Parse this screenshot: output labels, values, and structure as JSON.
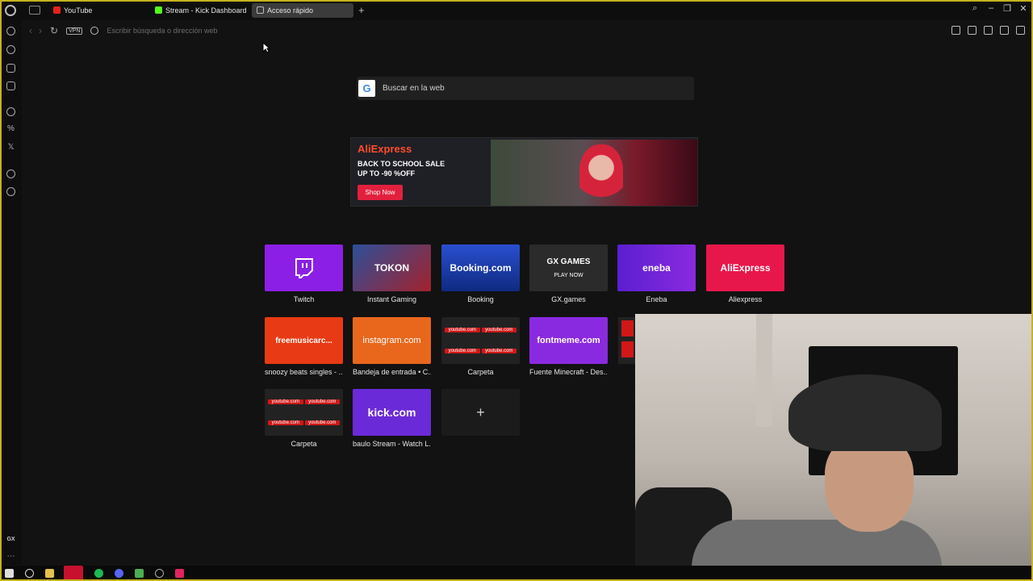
{
  "tabs": [
    {
      "label": "YouTube"
    },
    {
      "label": "Stream - Kick Dashboard"
    },
    {
      "label": "Acceso rápido"
    }
  ],
  "address": {
    "placeholder": "Escribir búsqueda o dirección web",
    "vpn_label": "VPN"
  },
  "sidebar": {
    "gx_label": "GX"
  },
  "search": {
    "label": "Buscar en la web",
    "g": "G"
  },
  "ad": {
    "brand": "AliExpress",
    "line1": "BACK TO SCHOOL SALE",
    "line2": "UP TO  -90 %OFF",
    "button": "Shop Now"
  },
  "speed_dial": [
    {
      "label": "Twitch",
      "thumb": "",
      "color": "#8c1fe6"
    },
    {
      "label": "Instant Gaming",
      "thumb": "TOKON",
      "color": "#2d4f9a"
    },
    {
      "label": "Booking",
      "thumb": "Booking.com",
      "color": "#1a47b8"
    },
    {
      "label": "GX.games",
      "thumb": "GX GAMES",
      "color": "#2b2b2b"
    },
    {
      "label": "Eneba",
      "thumb": "eneba",
      "color": "#6b2ad8"
    },
    {
      "label": "Aliexpress",
      "thumb": "AliExpress",
      "color": "#e8174b"
    },
    {
      "label": "snoozy beats singles - ...",
      "thumb": "freemusicarc...",
      "color": "#e83a14"
    },
    {
      "label": "Bandeja de entrada • C...",
      "thumb": "instagram.com",
      "color": "#e8671c"
    },
    {
      "label": "Carpeta",
      "thumb": "youtube.com",
      "color": "#222"
    },
    {
      "label": "Fuente Minecraft - Des...",
      "thumb": "fontmeme.com",
      "color": "#8a2ae0"
    },
    {
      "label": "Carpeta",
      "thumb": "youtube.com",
      "color": "#222"
    },
    {
      "label": "baulo Stream - Watch L...",
      "thumb": "kick.com",
      "color": "#6b2ad8"
    },
    {
      "label": "",
      "thumb": "+",
      "color": "#1b1b1b"
    }
  ],
  "gx_games_sub": "PLAY  NOW"
}
